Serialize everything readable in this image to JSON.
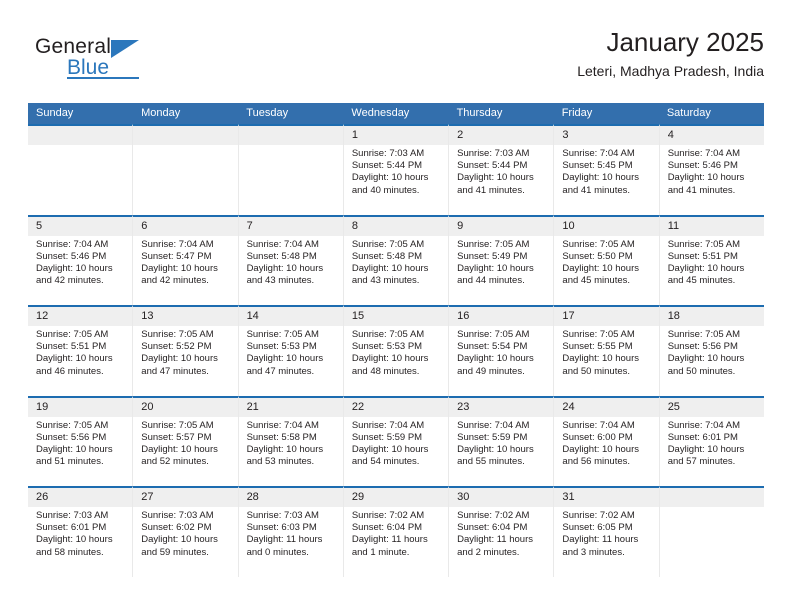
{
  "brand": {
    "name_part1": "General",
    "name_part2": "Blue",
    "logo_icon": "triangle-logo"
  },
  "header": {
    "title": "January 2025",
    "subtitle": "Leteri, Madhya Pradesh, India"
  },
  "colors": {
    "header_blue": "#336fad",
    "cell_top_border": "#1d6cb0",
    "brand_blue": "#2b77bc",
    "day_band": "#efefef",
    "text": "#231f20"
  },
  "weekdays": [
    "Sunday",
    "Monday",
    "Tuesday",
    "Wednesday",
    "Thursday",
    "Friday",
    "Saturday"
  ],
  "weeks": [
    [
      {
        "day": "",
        "empty": true
      },
      {
        "day": "",
        "empty": true
      },
      {
        "day": "",
        "empty": true
      },
      {
        "day": "1",
        "sunrise": "Sunrise: 7:03 AM",
        "sunset": "Sunset: 5:44 PM",
        "daylight": "Daylight: 10 hours and 40 minutes."
      },
      {
        "day": "2",
        "sunrise": "Sunrise: 7:03 AM",
        "sunset": "Sunset: 5:44 PM",
        "daylight": "Daylight: 10 hours and 41 minutes."
      },
      {
        "day": "3",
        "sunrise": "Sunrise: 7:04 AM",
        "sunset": "Sunset: 5:45 PM",
        "daylight": "Daylight: 10 hours and 41 minutes."
      },
      {
        "day": "4",
        "sunrise": "Sunrise: 7:04 AM",
        "sunset": "Sunset: 5:46 PM",
        "daylight": "Daylight: 10 hours and 41 minutes."
      }
    ],
    [
      {
        "day": "5",
        "sunrise": "Sunrise: 7:04 AM",
        "sunset": "Sunset: 5:46 PM",
        "daylight": "Daylight: 10 hours and 42 minutes."
      },
      {
        "day": "6",
        "sunrise": "Sunrise: 7:04 AM",
        "sunset": "Sunset: 5:47 PM",
        "daylight": "Daylight: 10 hours and 42 minutes."
      },
      {
        "day": "7",
        "sunrise": "Sunrise: 7:04 AM",
        "sunset": "Sunset: 5:48 PM",
        "daylight": "Daylight: 10 hours and 43 minutes."
      },
      {
        "day": "8",
        "sunrise": "Sunrise: 7:05 AM",
        "sunset": "Sunset: 5:48 PM",
        "daylight": "Daylight: 10 hours and 43 minutes."
      },
      {
        "day": "9",
        "sunrise": "Sunrise: 7:05 AM",
        "sunset": "Sunset: 5:49 PM",
        "daylight": "Daylight: 10 hours and 44 minutes."
      },
      {
        "day": "10",
        "sunrise": "Sunrise: 7:05 AM",
        "sunset": "Sunset: 5:50 PM",
        "daylight": "Daylight: 10 hours and 45 minutes."
      },
      {
        "day": "11",
        "sunrise": "Sunrise: 7:05 AM",
        "sunset": "Sunset: 5:51 PM",
        "daylight": "Daylight: 10 hours and 45 minutes."
      }
    ],
    [
      {
        "day": "12",
        "sunrise": "Sunrise: 7:05 AM",
        "sunset": "Sunset: 5:51 PM",
        "daylight": "Daylight: 10 hours and 46 minutes."
      },
      {
        "day": "13",
        "sunrise": "Sunrise: 7:05 AM",
        "sunset": "Sunset: 5:52 PM",
        "daylight": "Daylight: 10 hours and 47 minutes."
      },
      {
        "day": "14",
        "sunrise": "Sunrise: 7:05 AM",
        "sunset": "Sunset: 5:53 PM",
        "daylight": "Daylight: 10 hours and 47 minutes."
      },
      {
        "day": "15",
        "sunrise": "Sunrise: 7:05 AM",
        "sunset": "Sunset: 5:53 PM",
        "daylight": "Daylight: 10 hours and 48 minutes."
      },
      {
        "day": "16",
        "sunrise": "Sunrise: 7:05 AM",
        "sunset": "Sunset: 5:54 PM",
        "daylight": "Daylight: 10 hours and 49 minutes."
      },
      {
        "day": "17",
        "sunrise": "Sunrise: 7:05 AM",
        "sunset": "Sunset: 5:55 PM",
        "daylight": "Daylight: 10 hours and 50 minutes."
      },
      {
        "day": "18",
        "sunrise": "Sunrise: 7:05 AM",
        "sunset": "Sunset: 5:56 PM",
        "daylight": "Daylight: 10 hours and 50 minutes."
      }
    ],
    [
      {
        "day": "19",
        "sunrise": "Sunrise: 7:05 AM",
        "sunset": "Sunset: 5:56 PM",
        "daylight": "Daylight: 10 hours and 51 minutes."
      },
      {
        "day": "20",
        "sunrise": "Sunrise: 7:05 AM",
        "sunset": "Sunset: 5:57 PM",
        "daylight": "Daylight: 10 hours and 52 minutes."
      },
      {
        "day": "21",
        "sunrise": "Sunrise: 7:04 AM",
        "sunset": "Sunset: 5:58 PM",
        "daylight": "Daylight: 10 hours and 53 minutes."
      },
      {
        "day": "22",
        "sunrise": "Sunrise: 7:04 AM",
        "sunset": "Sunset: 5:59 PM",
        "daylight": "Daylight: 10 hours and 54 minutes."
      },
      {
        "day": "23",
        "sunrise": "Sunrise: 7:04 AM",
        "sunset": "Sunset: 5:59 PM",
        "daylight": "Daylight: 10 hours and 55 minutes."
      },
      {
        "day": "24",
        "sunrise": "Sunrise: 7:04 AM",
        "sunset": "Sunset: 6:00 PM",
        "daylight": "Daylight: 10 hours and 56 minutes."
      },
      {
        "day": "25",
        "sunrise": "Sunrise: 7:04 AM",
        "sunset": "Sunset: 6:01 PM",
        "daylight": "Daylight: 10 hours and 57 minutes."
      }
    ],
    [
      {
        "day": "26",
        "sunrise": "Sunrise: 7:03 AM",
        "sunset": "Sunset: 6:01 PM",
        "daylight": "Daylight: 10 hours and 58 minutes."
      },
      {
        "day": "27",
        "sunrise": "Sunrise: 7:03 AM",
        "sunset": "Sunset: 6:02 PM",
        "daylight": "Daylight: 10 hours and 59 minutes."
      },
      {
        "day": "28",
        "sunrise": "Sunrise: 7:03 AM",
        "sunset": "Sunset: 6:03 PM",
        "daylight": "Daylight: 11 hours and 0 minutes."
      },
      {
        "day": "29",
        "sunrise": "Sunrise: 7:02 AM",
        "sunset": "Sunset: 6:04 PM",
        "daylight": "Daylight: 11 hours and 1 minute."
      },
      {
        "day": "30",
        "sunrise": "Sunrise: 7:02 AM",
        "sunset": "Sunset: 6:04 PM",
        "daylight": "Daylight: 11 hours and 2 minutes."
      },
      {
        "day": "31",
        "sunrise": "Sunrise: 7:02 AM",
        "sunset": "Sunset: 6:05 PM",
        "daylight": "Daylight: 11 hours and 3 minutes."
      },
      {
        "day": "",
        "empty": true
      }
    ]
  ]
}
